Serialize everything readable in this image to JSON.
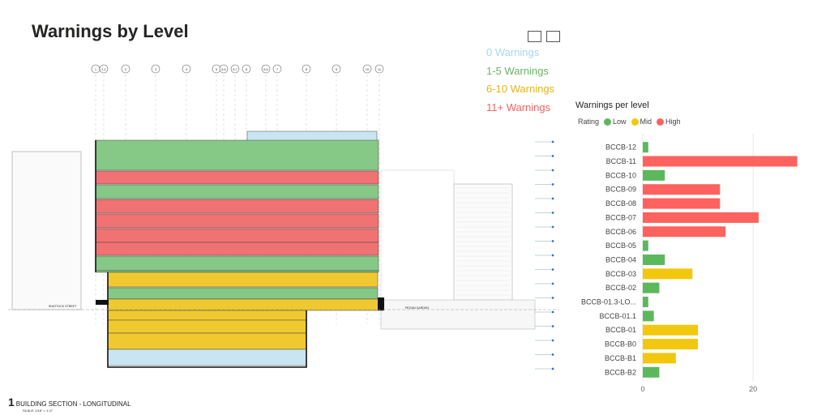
{
  "page_title": "Warnings by Level",
  "warning_legend": [
    {
      "label": "0 Warnings",
      "color": "#a9d7ea"
    },
    {
      "label": "1-5 Warnings",
      "color": "#6ab36a"
    },
    {
      "label": "6-10 Warnings",
      "color": "#e6b417"
    },
    {
      "label": "11+ Warnings",
      "color": "#f06262"
    }
  ],
  "section_caption": {
    "number": "1",
    "title": "BUILDING SECTION - LONGITUDINAL",
    "scale": "SCALE: 1/16\" = 1'-0\""
  },
  "section_labels": {
    "street": "SHATTUCK STREET",
    "garden": "PEGAN GARDEN"
  },
  "grid_labels": [
    "1",
    "1.1",
    "2",
    "3",
    "4",
    "5",
    "5.6",
    "5.7",
    "6",
    "6.6",
    "7",
    "8",
    "9",
    "10",
    "11"
  ],
  "section_bands": [
    {
      "level": "roof",
      "rating": "None"
    },
    {
      "level": "BCCB-12",
      "rating": "Low"
    },
    {
      "level": "BCCB-11",
      "rating": "High"
    },
    {
      "level": "BCCB-10",
      "rating": "Low"
    },
    {
      "level": "BCCB-09",
      "rating": "High"
    },
    {
      "level": "BCCB-08",
      "rating": "High"
    },
    {
      "level": "BCCB-07",
      "rating": "High"
    },
    {
      "level": "BCCB-06",
      "rating": "High"
    },
    {
      "level": "BCCB-05",
      "rating": "Low"
    },
    {
      "level": "BCCB-04",
      "rating": "Low"
    },
    {
      "level": "BCCB-03",
      "rating": "Mid"
    },
    {
      "level": "BCCB-02",
      "rating": "Low"
    },
    {
      "level": "BCCB-01.1",
      "rating": "Mid"
    },
    {
      "level": "BCCB-01",
      "rating": "Mid"
    },
    {
      "level": "BCCB-B0",
      "rating": "Mid"
    },
    {
      "level": "BCCB-B1",
      "rating": "Mid"
    },
    {
      "level": "BCCB-B2",
      "rating": "Low"
    },
    {
      "level": "Basement",
      "rating": "None"
    }
  ],
  "chart_data": {
    "type": "bar",
    "orientation": "horizontal",
    "title": "Warnings per level",
    "legend_title": "Rating",
    "legend": [
      {
        "name": "Low",
        "color": "#5cb85c"
      },
      {
        "name": "Mid",
        "color": "#f2c80f"
      },
      {
        "name": "High",
        "color": "#fd625e"
      }
    ],
    "categories": [
      "BCCB-12",
      "BCCB-11",
      "BCCB-10",
      "BCCB-09",
      "BCCB-08",
      "BCCB-07",
      "BCCB-06",
      "BCCB-05",
      "BCCB-04",
      "BCCB-03",
      "BCCB-02",
      "BCCB-01.3-LO...",
      "BCCB-01.1",
      "BCCB-01",
      "BCCB-B0",
      "BCCB-B1",
      "BCCB-B2"
    ],
    "values": [
      1,
      28,
      4,
      14,
      14,
      21,
      15,
      1,
      4,
      9,
      3,
      1,
      2,
      10,
      10,
      6,
      3
    ],
    "ratings": [
      "Low",
      "High",
      "Low",
      "High",
      "High",
      "High",
      "High",
      "Low",
      "Low",
      "Mid",
      "Low",
      "Low",
      "Low",
      "Mid",
      "Mid",
      "Mid",
      "Low"
    ],
    "xlim": [
      0,
      28.5
    ],
    "xticks": [
      0,
      20
    ],
    "grid": true
  }
}
